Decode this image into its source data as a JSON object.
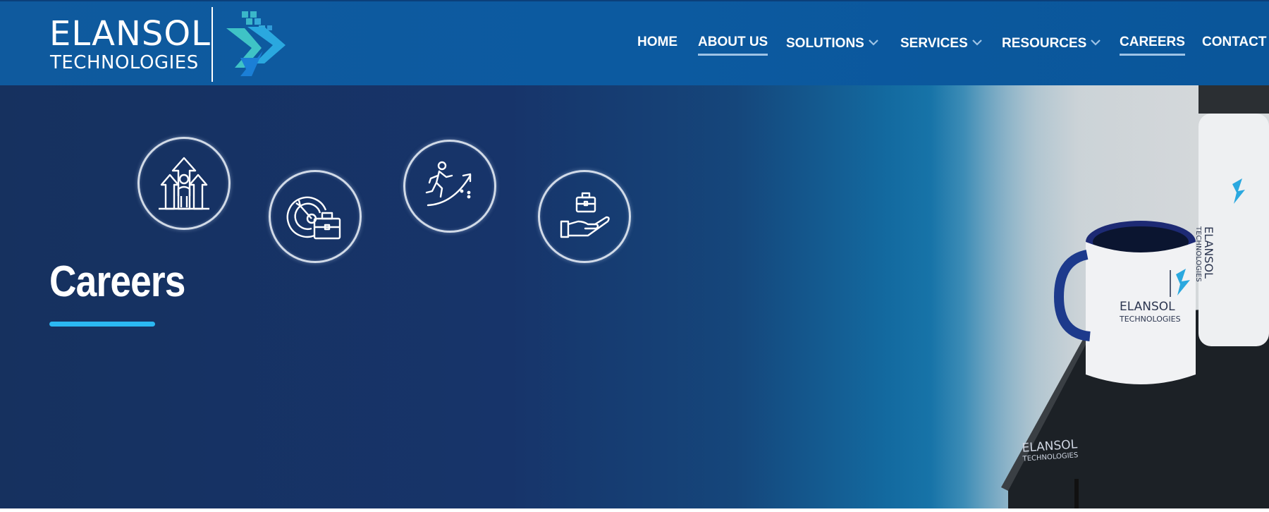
{
  "brand": {
    "name_line1": "ELANSOL",
    "name_line2": "TECHNOLOGIES",
    "colors": {
      "header": "#0c5aa0",
      "hero": "#16325f",
      "accent": "#2bb8f2",
      "logo_teal": "#3ab7c9"
    }
  },
  "nav": {
    "items": [
      {
        "label": "HOME",
        "has_dropdown": false,
        "underlined": false
      },
      {
        "label": "ABOUT US",
        "has_dropdown": false,
        "underlined": true
      },
      {
        "label": "SOLUTIONS",
        "has_dropdown": true,
        "underlined": false
      },
      {
        "label": "SERVICES",
        "has_dropdown": true,
        "underlined": false
      },
      {
        "label": "RESOURCES",
        "has_dropdown": true,
        "underlined": false
      },
      {
        "label": "CAREERS",
        "has_dropdown": false,
        "underlined": true
      },
      {
        "label": "CONTACT",
        "has_dropdown": false,
        "underlined": false
      }
    ]
  },
  "hero": {
    "title": "Careers",
    "icons": [
      "growth-arrows-person-icon",
      "target-briefcase-icon",
      "career-climb-icon",
      "hand-briefcase-icon"
    ],
    "photo": {
      "mug_text_line1": "ELANSOL",
      "mug_text_line2": "TECHNOLOGIES",
      "bottle_text_line1": "ELANSOL",
      "bottle_text_line2": "TECHNOLOGIES",
      "notebook_text_line1": "ELANSOL",
      "notebook_text_line2": "TECHNOLOGIES"
    }
  }
}
